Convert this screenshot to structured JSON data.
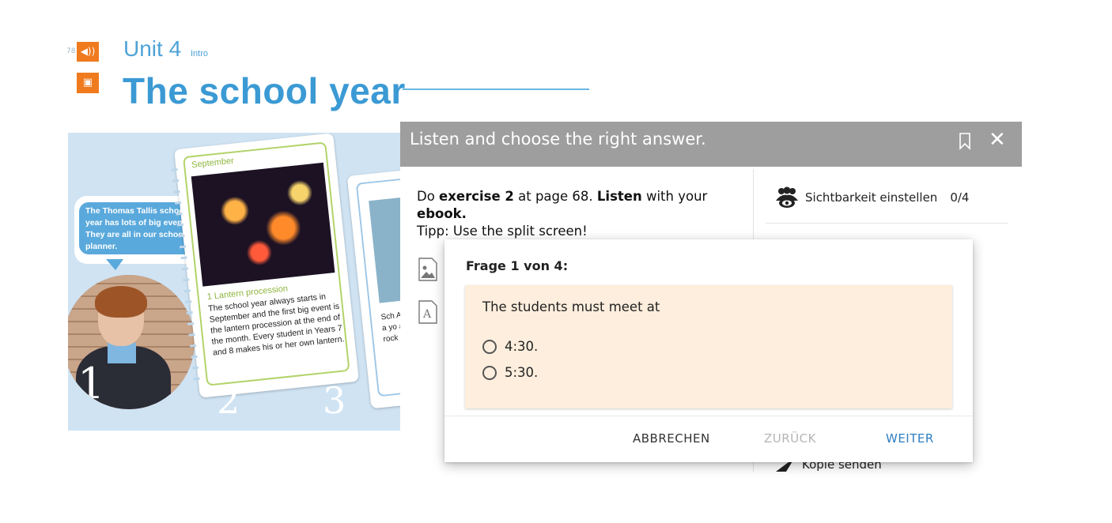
{
  "book": {
    "ref": "78",
    "unit": "Unit 4",
    "unit_sub": "Intro",
    "title": "The school year",
    "speech_bubble": "The Thomas Tallis school year has lots of big events. They are all in our school planner.",
    "card1": {
      "month": "September",
      "caption_title": "1 Lantern procession",
      "caption": "The school year always starts in September and the first big event is the lantern procession at the end of the month. Every student in Years 7 and 8 makes his or her own lantern."
    },
    "card2": {
      "caption": "Sch At t stu a yo acti rock visit"
    },
    "numbers": [
      "1",
      "2",
      "3"
    ]
  },
  "modal": {
    "title": "Listen and choose the right answer.",
    "instruction": {
      "p1": "Do ",
      "b1": "exercise 2",
      "p2": " at page 68. ",
      "b2": "Listen",
      "p3": " with your ",
      "b3": "ebook.",
      "tip": "Tipp: Use the split screen!"
    },
    "visibility_label": "Sichtbarkeit einstellen",
    "visibility_count": "0/4",
    "send_copy_label": "Kopie senden"
  },
  "question": {
    "counter": "Frage 1 von 4:",
    "text": "The students must meet at",
    "options": [
      "4:30.",
      "5:30."
    ],
    "buttons": {
      "cancel": "ABBRECHEN",
      "back": "ZURÜCK",
      "next": "WEITER"
    }
  },
  "colors": {
    "accent_blue": "#2f7fc1",
    "header_gray": "#9e9e9e",
    "question_bg": "#fdeedd",
    "title_blue": "#3b9ad4",
    "badge_orange": "#f07a1e"
  }
}
